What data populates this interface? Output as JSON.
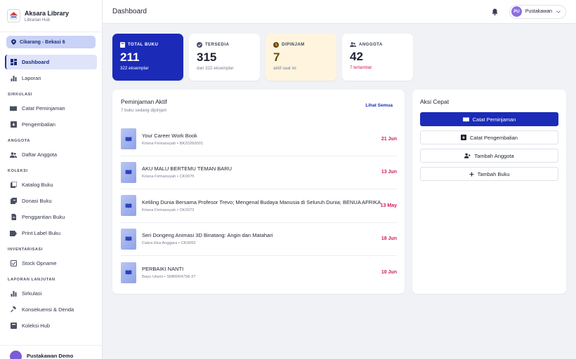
{
  "brand": {
    "title": "Aksara Library",
    "subtitle": "Librarian Hub"
  },
  "branch": "Cikarang - Bekasi 6",
  "nav": {
    "dashboard": "Dashboard",
    "laporan": "Laporan",
    "section_sirkulasi": "SIRKULASI",
    "catat_peminjaman": "Catat Peminjaman",
    "pengembalian": "Pengembalian",
    "section_anggota": "ANGGOTA",
    "daftar_anggota": "Daftar Anggota",
    "section_koleksi": "KOLEKSI",
    "katalog_buku": "Katalog Buku",
    "donasi_buku": "Donasi Buku",
    "penggantian_buku": "Penggantian Buku",
    "print_label_buku": "Print Label Buku",
    "section_inventarisasi": "INVENTARISASI",
    "stock_opname": "Stock Opname",
    "section_laporan_lanjutan": "LAPORAN LANJUTAN",
    "sirkulasi": "Sirkulasi",
    "konsekuensi_denda": "Konsekuensi & Denda",
    "koleksi_hub": "Koleksi Hub"
  },
  "footer_user": "Pustakawan Demo",
  "topbar": {
    "title": "Dashboard",
    "user_initials": "PU",
    "user_name": "Pustakawan"
  },
  "stats": [
    {
      "label": "TOTAL BUKU",
      "value": "211",
      "sub": "322 eksemplar"
    },
    {
      "label": "TERSEDIA",
      "value": "315",
      "sub": "dari 322 eksemplar"
    },
    {
      "label": "DIPINJAM",
      "value": "7",
      "sub": "aktif saat ini"
    },
    {
      "label": "ANGGOTA",
      "value": "42",
      "sub": "7 terlambat"
    }
  ],
  "loans": {
    "title": "Peminjaman Aktif",
    "subtitle": "7 buku sedang dipinjam",
    "see_all": "Lihat Semua",
    "items": [
      {
        "title": "Your Career Work Book",
        "meta": "Krisna Firmansyah • BK20260001",
        "date": "21 Jun"
      },
      {
        "title": "AKU MALU BERTEMU TEMAN BARU",
        "meta": "Krisna Firmansyah • CK0075",
        "date": "13 Jun"
      },
      {
        "title": "Keliling Dunia Bersama Profesor Trevo; Mengenal Budaya Manusia di Seluruh Dunia; BENUA AFRIKA",
        "meta": "Krisna Firmansyah • CK0372",
        "date": "13 May"
      },
      {
        "title": "Seri Dongeng Animasi 3D Binatang: Angin dan Matahari",
        "meta": "Cakra Eka Anggara • CK0093",
        "date": "18 Jun"
      },
      {
        "title": "PERBAIKI NANTI",
        "meta": "Bayu Utami • SMM004758-37",
        "date": "10 Jun"
      }
    ]
  },
  "quick": {
    "title": "Aksi Cepat",
    "catat_peminjaman": "Catat Peminjaman",
    "catat_pengembalian": "Catat Pengembalian",
    "tambah_anggota": "Tambah Anggota",
    "tambah_buku": "Tambah Buku"
  },
  "colors": {
    "primary": "#1b2bb8",
    "overdue": "#d01d55",
    "warn_bg": "#fff5df"
  }
}
